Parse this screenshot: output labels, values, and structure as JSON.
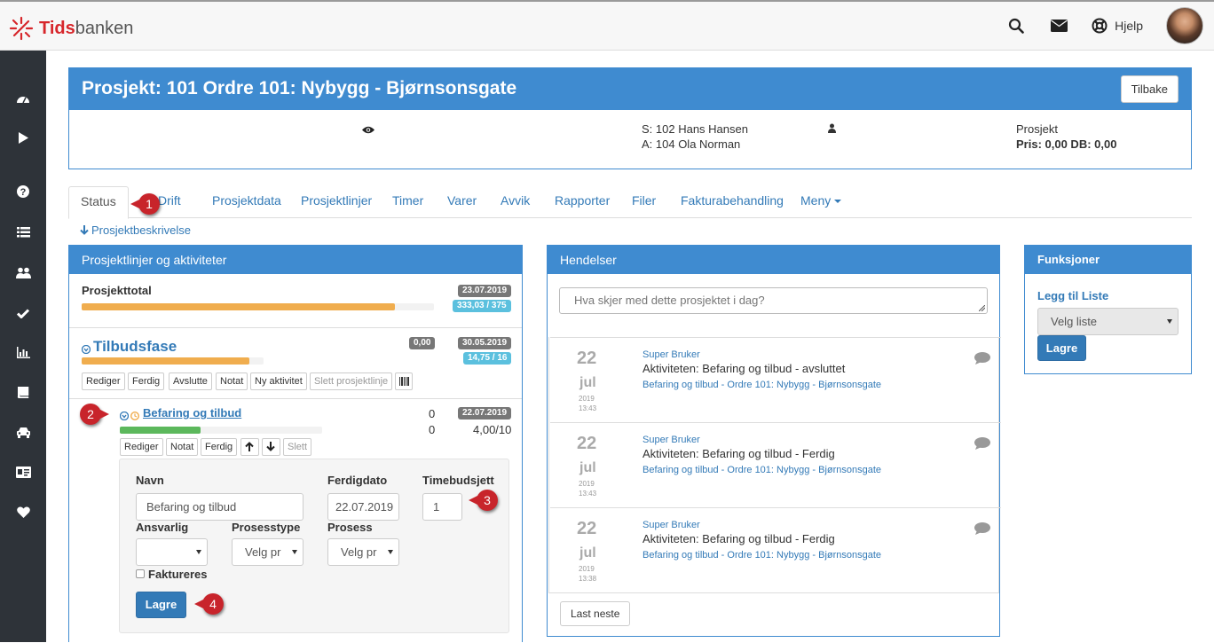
{
  "app": {
    "logo_part1": "Tids",
    "logo_part2": "banken",
    "help_label": "Hjelp"
  },
  "project": {
    "title": "Prosjekt: 101 Ordre 101: Nybygg - Bjørnsonsgate",
    "back_label": "Tilbake",
    "s_line": "S: 102 Hans Hansen",
    "a_line": "A: 104 Ola Norman",
    "type": "Prosjekt",
    "price": "Pris: 0,00 DB: 0,00"
  },
  "tabs": [
    {
      "label": "Status"
    },
    {
      "label": "Drift"
    },
    {
      "label": "Prosjektdata"
    },
    {
      "label": "Prosjektlinjer"
    },
    {
      "label": "Timer"
    },
    {
      "label": "Varer"
    },
    {
      "label": "Avvik"
    },
    {
      "label": "Rapporter"
    },
    {
      "label": "Filer"
    },
    {
      "label": "Fakturabehandling"
    },
    {
      "label": "Meny"
    }
  ],
  "desc_link": "Prosjektbeskrivelse",
  "lines_panel": {
    "title": "Prosjektlinjer og aktiviteter",
    "total": {
      "name": "Prosjekttotal",
      "date": "23.07.2019",
      "hours": "333,03 / 375",
      "progress": 0.89
    },
    "phase": {
      "name": "Tilbudsfase",
      "amount": "0,00",
      "date": "30.05.2019",
      "hours": "14,75 / 16",
      "progress": 0.92,
      "buttons": [
        "Rediger",
        "Ferdig",
        "Avslutte",
        "Notat",
        "Ny aktivitet",
        "Slett prosjektlinje"
      ]
    },
    "activity": {
      "name": "Befaring og tilbud",
      "count1": "0",
      "count2": "0",
      "date": "22.07.2019",
      "hours": "4,00/10",
      "progress": 0.4,
      "buttons": [
        "Rediger",
        "Notat",
        "Ferdig",
        "Slett"
      ]
    },
    "form": {
      "name_label": "Navn",
      "name_value": "Befaring og tilbud",
      "date_label": "Ferdigdato",
      "date_value": "22.07.2019",
      "budget_label": "Timebudsjett",
      "budget_value": "1",
      "resp_label": "Ansvarlig",
      "resp_value": "",
      "ptype_label": "Prosesstype",
      "ptype_value": "Velg pr",
      "proc_label": "Prosess",
      "proc_value": "Velg pr",
      "invoice_label": "Faktureres",
      "save_label": "Lagre"
    }
  },
  "events_panel": {
    "title": "Hendelser",
    "placeholder": "Hva skjer med dette prosjektet i dag?",
    "items": [
      {
        "day": "22",
        "month": "jul",
        "year": "2019",
        "time": "13:43",
        "user": "Super Bruker",
        "text": "Aktiviteten: Befaring og tilbud - avsluttet",
        "link": "Befaring og tilbud - Ordre 101: Nybygg - Bjørnsonsgate"
      },
      {
        "day": "22",
        "month": "jul",
        "year": "2019",
        "time": "13:43",
        "user": "Super Bruker",
        "text": "Aktiviteten: Befaring og tilbud - Ferdig",
        "link": "Befaring og tilbud - Ordre 101: Nybygg - Bjørnsonsgate"
      },
      {
        "day": "22",
        "month": "jul",
        "year": "2019",
        "time": "13:38",
        "user": "Super Bruker",
        "text": "Aktiviteten: Befaring og tilbud - Ferdig",
        "link": "Befaring og tilbud - Ordre 101: Nybygg - Bjørnsonsgate"
      }
    ],
    "more_label": "Last neste"
  },
  "functions_panel": {
    "title": "Funksjoner",
    "list_link": "Legg til Liste",
    "select_value": "Velg liste",
    "save_label": "Lagre"
  },
  "callouts": [
    "1",
    "2",
    "3",
    "4"
  ],
  "colors": {
    "primary": "#3f8bd0",
    "sidebar": "#2e3339",
    "progress_orange": "#f0ad4e",
    "progress_green": "#5cb85c",
    "callout": "#c8242b"
  }
}
